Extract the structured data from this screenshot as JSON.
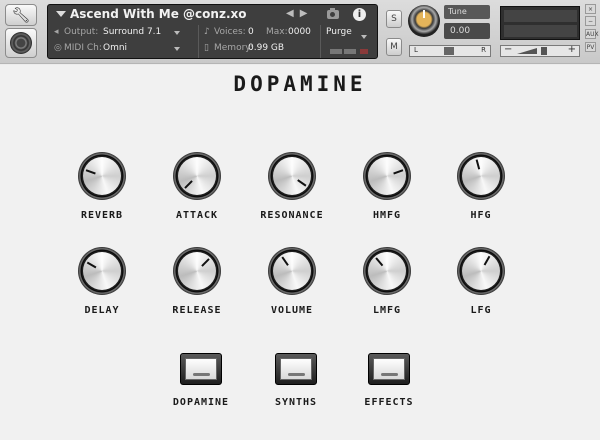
{
  "header": {
    "instrument_name": "Ascend With Me @conz.xo",
    "output_label": "Output:",
    "output_value": "Surround 7.1",
    "voices_label": "Voices:",
    "voices_value": "0",
    "max_label": "Max:",
    "max_value": "0000",
    "midi_label": "MIDI Ch:",
    "midi_value": "Omni",
    "memory_label": "Memory:",
    "memory_value": "0.99 GB",
    "purge_label": "Purge",
    "solo_label": "S",
    "mute_label": "M",
    "tune_label": "Tune",
    "tune_value": "0.00",
    "pan_left": "L",
    "pan_right": "R",
    "vol_minus": "−",
    "vol_plus": "+",
    "side_buttons": [
      "×",
      "−",
      "AUX",
      "PV"
    ]
  },
  "panel": {
    "title": "DOPAMINE",
    "knobs_row1": [
      {
        "label": "REVERB",
        "angle": -70
      },
      {
        "label": "ATTACK",
        "angle": -135
      },
      {
        "label": "RESONANCE",
        "angle": 125
      },
      {
        "label": "HMFG",
        "angle": 70
      },
      {
        "label": "HFG",
        "angle": -15
      }
    ],
    "knobs_row2": [
      {
        "label": "DELAY",
        "angle": -60
      },
      {
        "label": "RELEASE",
        "angle": 45
      },
      {
        "label": "VOLUME",
        "angle": -35
      },
      {
        "label": "LMFG",
        "angle": -40
      },
      {
        "label": "LFG",
        "angle": 30
      }
    ],
    "page_buttons": [
      {
        "label": "DOPAMINE"
      },
      {
        "label": "SYNTHS"
      },
      {
        "label": "EFFECTS"
      }
    ]
  }
}
